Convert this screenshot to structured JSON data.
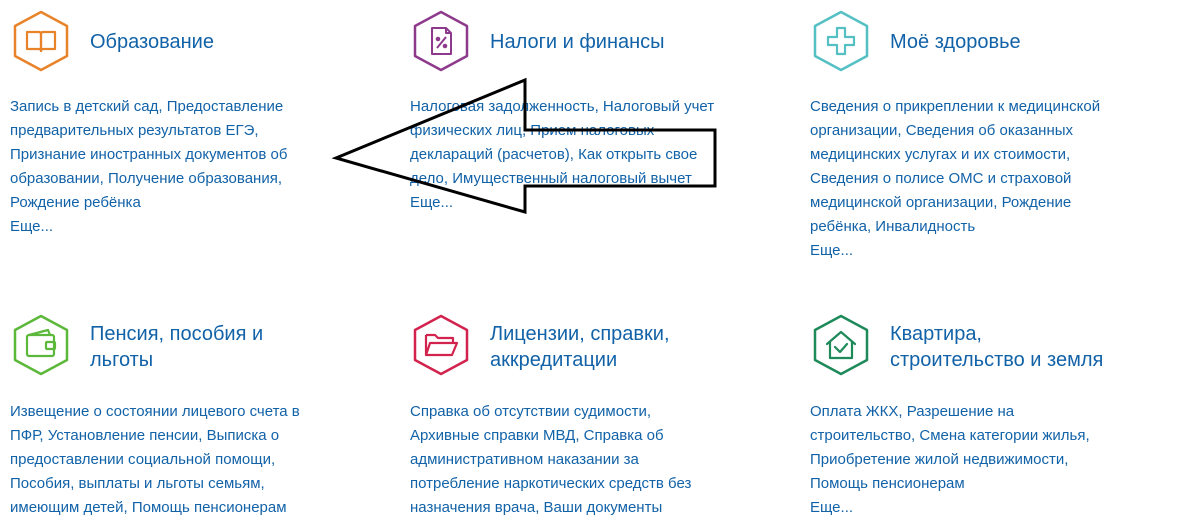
{
  "categories": [
    {
      "title": "Образование",
      "icon": "book-icon",
      "color": "#e8832a",
      "lines": [
        "Запись в детский сад, Предоставление",
        "предварительных результатов ЕГЭ,",
        "Признание иностранных документов об",
        "образовании, Получение образования,",
        "Рождение ребёнка"
      ],
      "more": "Еще..."
    },
    {
      "title": "Налоги и финансы",
      "icon": "tax-document-icon",
      "color": "#8e3a8c",
      "lines": [
        "Налоговая задолженность, Налоговый учет",
        "физических лиц, Прием налоговых",
        "деклараций (расчетов), Как открыть свое",
        "дело, Имущественный налоговый вычет"
      ],
      "more": "Еще..."
    },
    {
      "title": "Моё здоровье",
      "icon": "medical-cross-icon",
      "color": "#55c0c4",
      "lines": [
        "Сведения о прикреплении к медицинской",
        "организации, Сведения об оказанных",
        "медицинских услугах и их стоимости,",
        "Сведения о полисе ОМС и страховой",
        "медицинской организации, Рождение",
        "ребёнка, Инвалидность"
      ],
      "more": "Еще..."
    },
    {
      "title_lines": [
        "Пенсия, пособия и",
        "льготы"
      ],
      "icon": "wallet-icon",
      "color": "#5cb83a",
      "lines": [
        "Извещение о состоянии лицевого счета в",
        "ПФР, Установление пенсии, Выписка о",
        "предоставлении социальной помощи,",
        "Пособия, выплаты и льготы семьям,",
        "имеющим детей, Помощь пенсионерам"
      ],
      "more": ""
    },
    {
      "title_lines": [
        "Лицензии, справки,",
        "аккредитации"
      ],
      "icon": "folder-icon",
      "color": "#d2234f",
      "lines": [
        "Справка об отсутствии судимости,",
        "Архивные справки МВД, Справка об",
        "административном наказании за",
        "потребление наркотических средств без",
        "назначения врача, Ваши документы"
      ],
      "more": ""
    },
    {
      "title_lines": [
        "Квартира,",
        "строительство и земля"
      ],
      "icon": "house-check-icon",
      "color": "#1e8a5a",
      "lines": [
        "Оплата ЖКХ, Разрешение на",
        "строительство, Смена категории жилья,",
        "Приобретение жилой недвижимости,",
        "Помощь пенсионерам"
      ],
      "more": "Еще..."
    }
  ]
}
